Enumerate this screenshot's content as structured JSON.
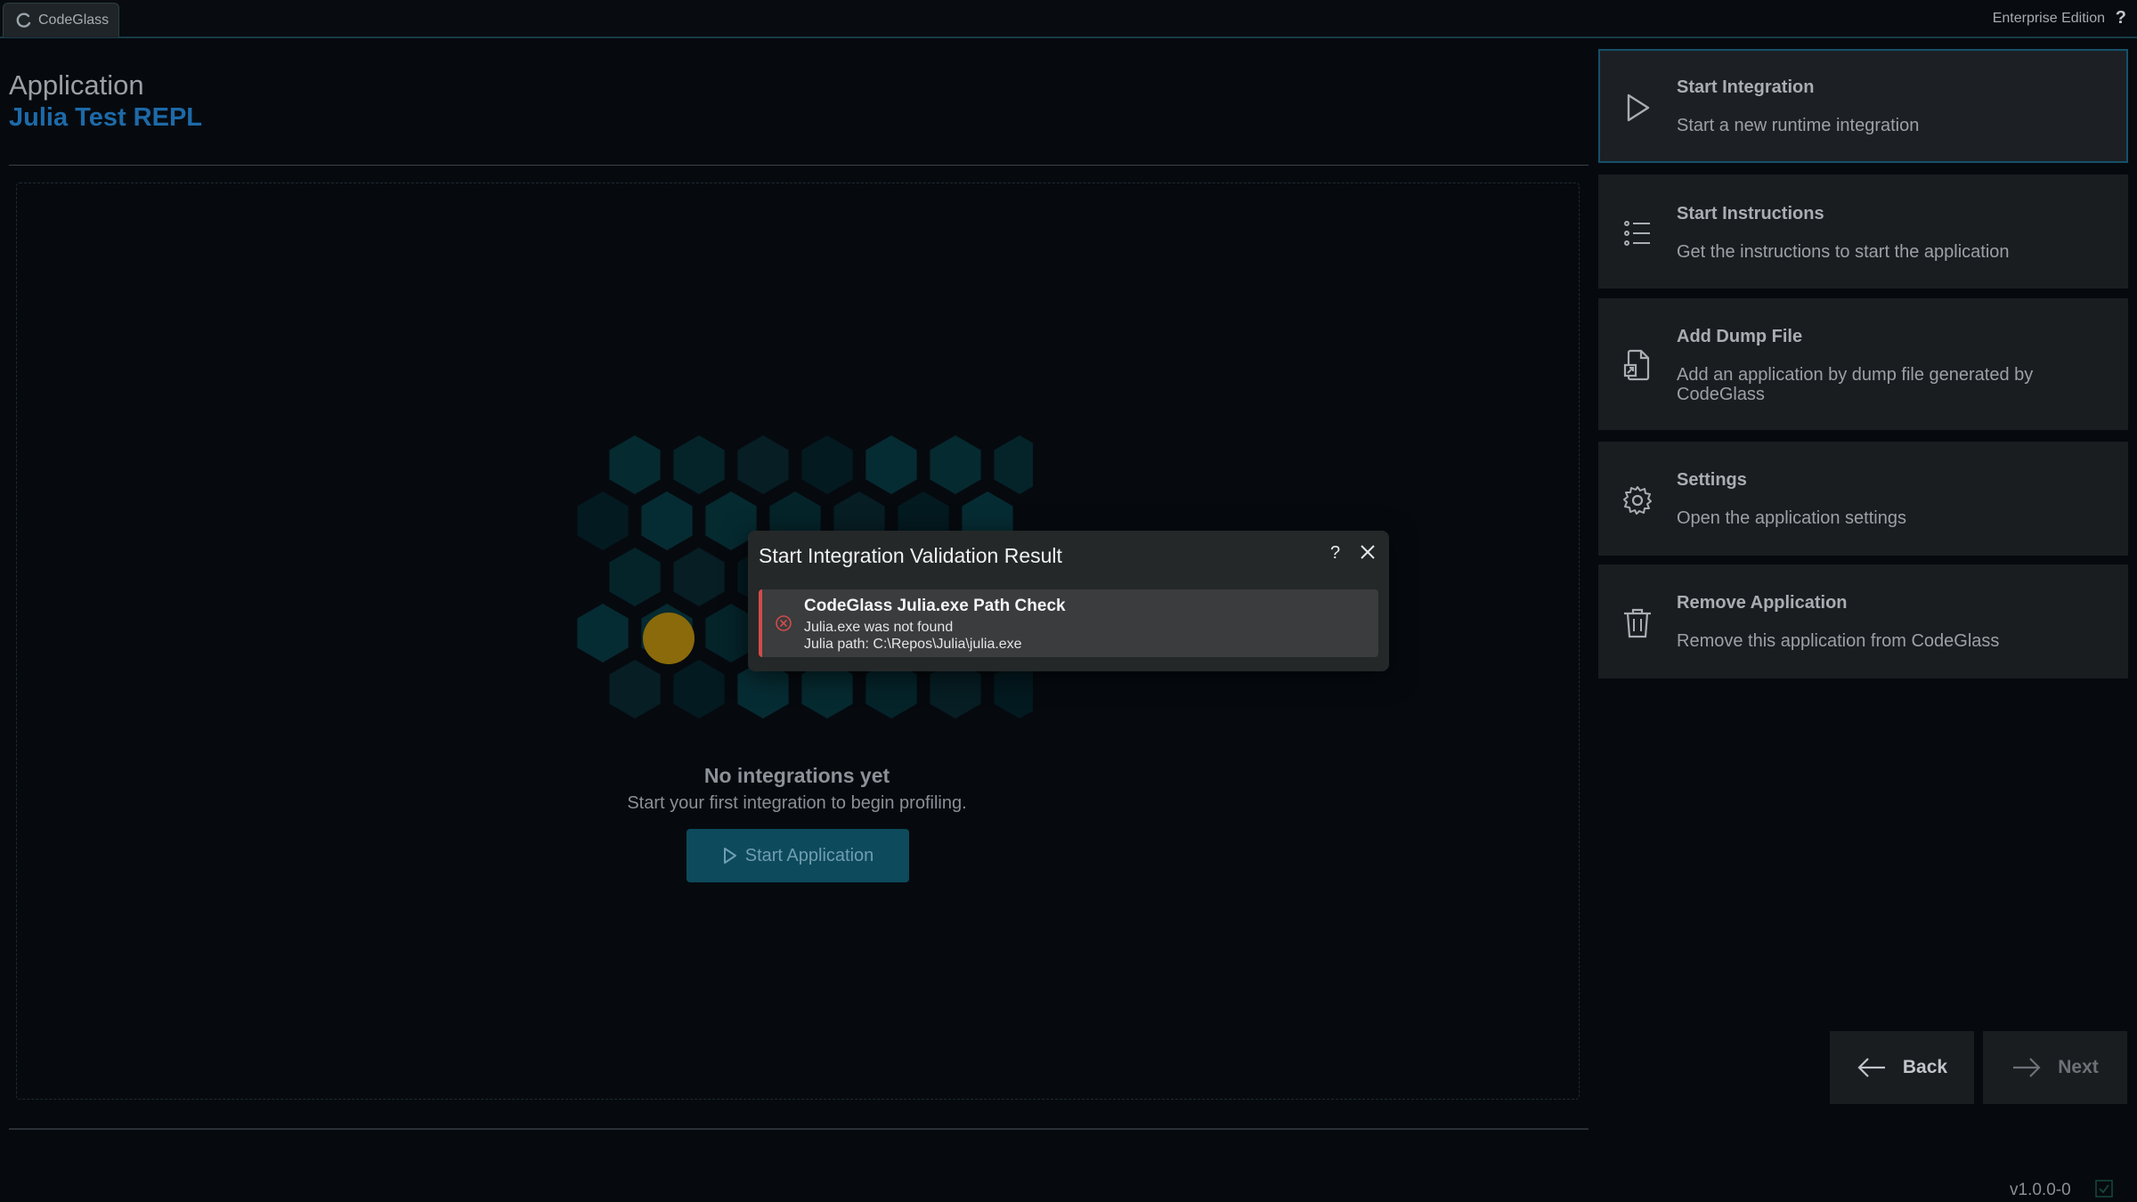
{
  "topbar": {
    "app_name": "CodeGlass",
    "edition": "Enterprise Edition",
    "help": "?"
  },
  "header": {
    "label": "Application",
    "title": "Julia Test REPL"
  },
  "empty_state": {
    "title": "No integrations yet",
    "subtitle": "Start your first integration to begin profiling.",
    "button": "Start Application"
  },
  "actions": [
    {
      "title": "Start Integration",
      "desc": "Start a new runtime integration",
      "icon": "play-icon"
    },
    {
      "title": "Start Instructions",
      "desc": "Get the instructions to start the application",
      "icon": "list-icon"
    },
    {
      "title": "Add Dump File",
      "desc": "Add an application by dump file generated by CodeGlass",
      "icon": "dump-file-icon"
    },
    {
      "title": "Settings",
      "desc": "Open the application settings",
      "icon": "gear-icon"
    },
    {
      "title": "Remove Application",
      "desc": "Remove this application from CodeGlass",
      "icon": "trash-icon"
    }
  ],
  "nav": {
    "back": "Back",
    "next": "Next"
  },
  "version": "v1.0.0-0",
  "dialog": {
    "title": "Start Integration Validation Result",
    "help": "?",
    "result": {
      "status": "error",
      "title": "CodeGlass Julia.exe Path Check",
      "line1": "Julia.exe was not found",
      "line2": "Julia path: C:\\Repos\\Julia\\julia.exe"
    }
  },
  "colors": {
    "accent": "#1d6aa8",
    "error": "#d24b4b",
    "active_border": "#16506a",
    "hex_highlight": "#8a6a0a"
  }
}
